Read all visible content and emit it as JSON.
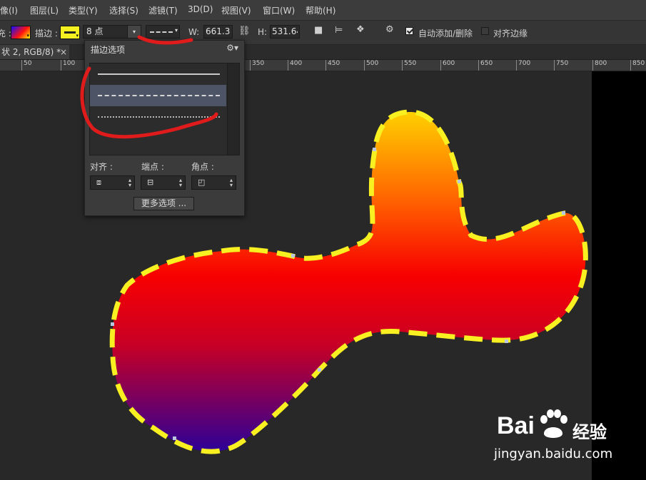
{
  "menubar": {
    "items": [
      "像(I)",
      "图层(L)",
      "类型(Y)",
      "选择(S)",
      "滤镜(T)",
      "3D(D)",
      "视图(V)",
      "窗口(W)",
      "帮助(H)"
    ]
  },
  "options": {
    "fill_label": "充 :",
    "stroke_label": "描边 :",
    "stroke_width": "8 点",
    "w_label": "W:",
    "w_value": "661.35",
    "h_label": "H:",
    "h_value": "531.64",
    "auto_add_delete": "自动添加/删除",
    "auto_add_delete_checked": true,
    "align_edges": "对齐边缘",
    "align_edges_checked": false
  },
  "document_tab": {
    "title": "状 2, RGB/8) *",
    "close": "×"
  },
  "ruler": {
    "labels": [
      "50",
      "100",
      "350",
      "400",
      "450",
      "500",
      "550",
      "600",
      "650",
      "700",
      "750",
      "800",
      "850"
    ]
  },
  "stroke_panel": {
    "title": "描边选项",
    "line_types": [
      "solid",
      "dashed",
      "dotted"
    ],
    "selected_line_type": "dashed",
    "align_label": "对齐 :",
    "caps_label": "端点 :",
    "corners_label": "角点 :",
    "more_options": "更多选项 ..."
  },
  "shape": {
    "gradient_colors": [
      "#ffd200",
      "#ff5a00",
      "#f80000",
      "#c80025",
      "#28009a"
    ],
    "stroke_color": "#f8f020"
  },
  "watermark": {
    "brand": "Bai",
    "brand_suffix": "经验",
    "url": "jingyan.baidu.com"
  }
}
